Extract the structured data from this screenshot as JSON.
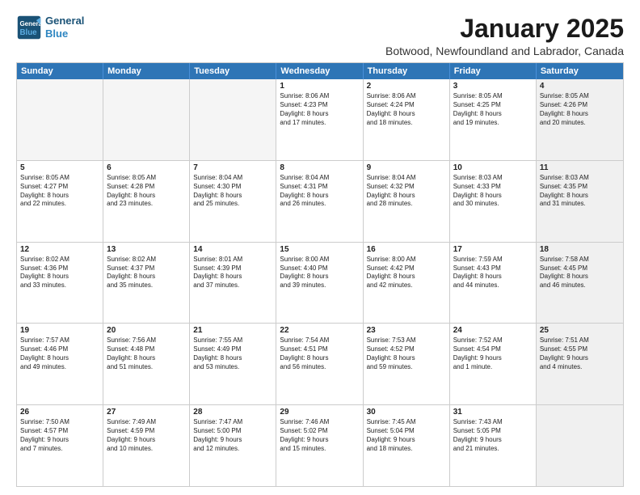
{
  "header": {
    "logo_line1": "General",
    "logo_line2": "Blue",
    "month": "January 2025",
    "location": "Botwood, Newfoundland and Labrador, Canada"
  },
  "days_of_week": [
    "Sunday",
    "Monday",
    "Tuesday",
    "Wednesday",
    "Thursday",
    "Friday",
    "Saturday"
  ],
  "weeks": [
    [
      {
        "day": "",
        "content": "",
        "empty": true
      },
      {
        "day": "",
        "content": "",
        "empty": true
      },
      {
        "day": "",
        "content": "",
        "empty": true
      },
      {
        "day": "1",
        "content": "Sunrise: 8:06 AM\nSunset: 4:23 PM\nDaylight: 8 hours\nand 17 minutes."
      },
      {
        "day": "2",
        "content": "Sunrise: 8:06 AM\nSunset: 4:24 PM\nDaylight: 8 hours\nand 18 minutes."
      },
      {
        "day": "3",
        "content": "Sunrise: 8:05 AM\nSunset: 4:25 PM\nDaylight: 8 hours\nand 19 minutes."
      },
      {
        "day": "4",
        "content": "Sunrise: 8:05 AM\nSunset: 4:26 PM\nDaylight: 8 hours\nand 20 minutes.",
        "shaded": true
      }
    ],
    [
      {
        "day": "5",
        "content": "Sunrise: 8:05 AM\nSunset: 4:27 PM\nDaylight: 8 hours\nand 22 minutes."
      },
      {
        "day": "6",
        "content": "Sunrise: 8:05 AM\nSunset: 4:28 PM\nDaylight: 8 hours\nand 23 minutes."
      },
      {
        "day": "7",
        "content": "Sunrise: 8:04 AM\nSunset: 4:30 PM\nDaylight: 8 hours\nand 25 minutes."
      },
      {
        "day": "8",
        "content": "Sunrise: 8:04 AM\nSunset: 4:31 PM\nDaylight: 8 hours\nand 26 minutes."
      },
      {
        "day": "9",
        "content": "Sunrise: 8:04 AM\nSunset: 4:32 PM\nDaylight: 8 hours\nand 28 minutes."
      },
      {
        "day": "10",
        "content": "Sunrise: 8:03 AM\nSunset: 4:33 PM\nDaylight: 8 hours\nand 30 minutes."
      },
      {
        "day": "11",
        "content": "Sunrise: 8:03 AM\nSunset: 4:35 PM\nDaylight: 8 hours\nand 31 minutes.",
        "shaded": true
      }
    ],
    [
      {
        "day": "12",
        "content": "Sunrise: 8:02 AM\nSunset: 4:36 PM\nDaylight: 8 hours\nand 33 minutes."
      },
      {
        "day": "13",
        "content": "Sunrise: 8:02 AM\nSunset: 4:37 PM\nDaylight: 8 hours\nand 35 minutes."
      },
      {
        "day": "14",
        "content": "Sunrise: 8:01 AM\nSunset: 4:39 PM\nDaylight: 8 hours\nand 37 minutes."
      },
      {
        "day": "15",
        "content": "Sunrise: 8:00 AM\nSunset: 4:40 PM\nDaylight: 8 hours\nand 39 minutes."
      },
      {
        "day": "16",
        "content": "Sunrise: 8:00 AM\nSunset: 4:42 PM\nDaylight: 8 hours\nand 42 minutes."
      },
      {
        "day": "17",
        "content": "Sunrise: 7:59 AM\nSunset: 4:43 PM\nDaylight: 8 hours\nand 44 minutes."
      },
      {
        "day": "18",
        "content": "Sunrise: 7:58 AM\nSunset: 4:45 PM\nDaylight: 8 hours\nand 46 minutes.",
        "shaded": true
      }
    ],
    [
      {
        "day": "19",
        "content": "Sunrise: 7:57 AM\nSunset: 4:46 PM\nDaylight: 8 hours\nand 49 minutes."
      },
      {
        "day": "20",
        "content": "Sunrise: 7:56 AM\nSunset: 4:48 PM\nDaylight: 8 hours\nand 51 minutes."
      },
      {
        "day": "21",
        "content": "Sunrise: 7:55 AM\nSunset: 4:49 PM\nDaylight: 8 hours\nand 53 minutes."
      },
      {
        "day": "22",
        "content": "Sunrise: 7:54 AM\nSunset: 4:51 PM\nDaylight: 8 hours\nand 56 minutes."
      },
      {
        "day": "23",
        "content": "Sunrise: 7:53 AM\nSunset: 4:52 PM\nDaylight: 8 hours\nand 59 minutes."
      },
      {
        "day": "24",
        "content": "Sunrise: 7:52 AM\nSunset: 4:54 PM\nDaylight: 9 hours\nand 1 minute."
      },
      {
        "day": "25",
        "content": "Sunrise: 7:51 AM\nSunset: 4:55 PM\nDaylight: 9 hours\nand 4 minutes.",
        "shaded": true
      }
    ],
    [
      {
        "day": "26",
        "content": "Sunrise: 7:50 AM\nSunset: 4:57 PM\nDaylight: 9 hours\nand 7 minutes."
      },
      {
        "day": "27",
        "content": "Sunrise: 7:49 AM\nSunset: 4:59 PM\nDaylight: 9 hours\nand 10 minutes."
      },
      {
        "day": "28",
        "content": "Sunrise: 7:47 AM\nSunset: 5:00 PM\nDaylight: 9 hours\nand 12 minutes."
      },
      {
        "day": "29",
        "content": "Sunrise: 7:46 AM\nSunset: 5:02 PM\nDaylight: 9 hours\nand 15 minutes."
      },
      {
        "day": "30",
        "content": "Sunrise: 7:45 AM\nSunset: 5:04 PM\nDaylight: 9 hours\nand 18 minutes."
      },
      {
        "day": "31",
        "content": "Sunrise: 7:43 AM\nSunset: 5:05 PM\nDaylight: 9 hours\nand 21 minutes."
      },
      {
        "day": "",
        "content": "",
        "empty": true,
        "shaded": true
      }
    ]
  ]
}
